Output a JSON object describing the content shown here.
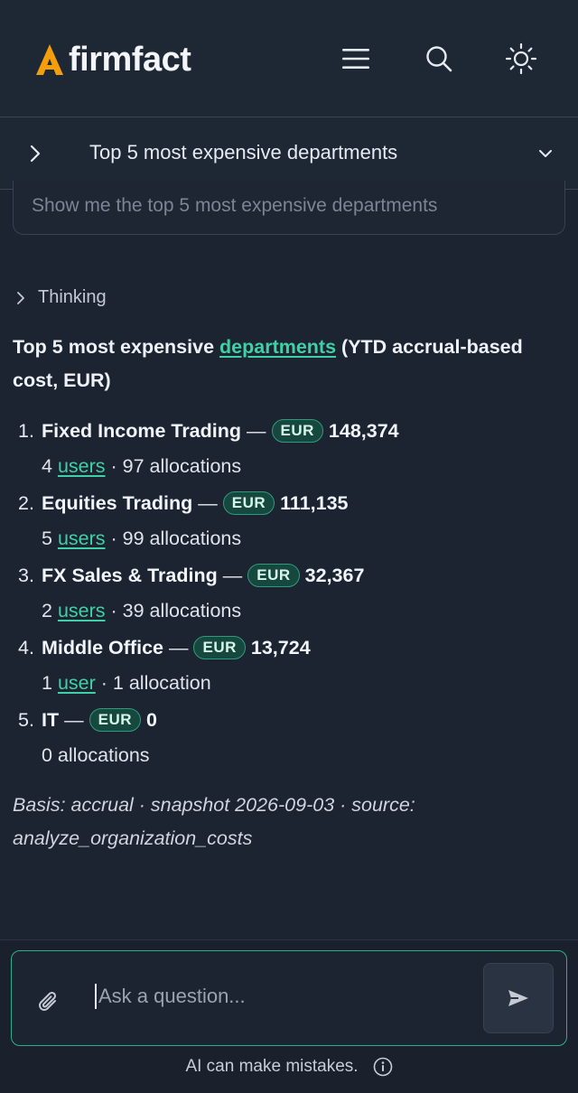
{
  "app": {
    "name": "firmfact",
    "accent_color": "#f59e0b"
  },
  "header": {
    "menu_icon": "hamburger-menu-icon",
    "search_icon": "search-icon",
    "theme_icon": "sun-icon"
  },
  "conversation": {
    "title": "Top 5 most expensive departments",
    "user_message": "Show me the top 5 most expensive departments",
    "thinking_label": "Thinking"
  },
  "answer": {
    "title_prefix": "Top 5 most expensive ",
    "title_link": "departments",
    "title_suffix": " (YTD accrual-based cost, EUR)",
    "currency_badge": "EUR",
    "departments": [
      {
        "rank": "1.",
        "name": "Fixed Income Trading",
        "amount": "148,374",
        "users_count": "4",
        "users_label": "users",
        "allocations": "· 97 allocations"
      },
      {
        "rank": "2.",
        "name": "Equities Trading",
        "amount": "111,135",
        "users_count": "5",
        "users_label": "users",
        "allocations": "· 99 allocations"
      },
      {
        "rank": "3.",
        "name": "FX Sales & Trading",
        "amount": "32,367",
        "users_count": "2",
        "users_label": "users",
        "allocations": "· 39 allocations"
      },
      {
        "rank": "4.",
        "name": "Middle Office",
        "amount": "13,724",
        "users_count": "1",
        "users_label": "user",
        "allocations": "· 1 allocation"
      },
      {
        "rank": "5.",
        "name": "IT",
        "amount": "0",
        "users_count": "",
        "users_label": "",
        "allocations": "0 allocations"
      }
    ],
    "basis": "Basis: accrual · snapshot 2026-09-03 · source: analyze_organization_costs"
  },
  "composer": {
    "placeholder": "Ask a question...",
    "attach_icon": "paperclip-icon",
    "send_icon": "send-icon"
  },
  "footer": {
    "disclaimer": "AI can make mistakes.",
    "info_icon": "info-icon"
  }
}
